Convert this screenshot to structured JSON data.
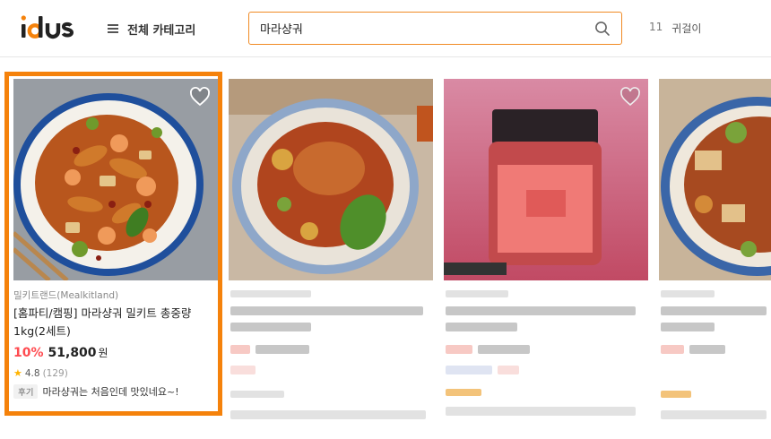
{
  "header": {
    "logo_text": "idus",
    "category_label": "전체 카테고리",
    "search": {
      "value": "마라샹궈",
      "placeholder": ""
    },
    "trending": {
      "rank": "11",
      "keyword": "귀걸이"
    }
  },
  "products": [
    {
      "seller": "밀키트랜드(Mealkitland)",
      "title": "[홈파티/캠핑] 마라샹궈 밀키트 총중량 1kg(2세트)",
      "discount": "10%",
      "price": "51,800",
      "currency": "원",
      "rating": "4.8",
      "review_count": "(129)",
      "review_tag": "후기",
      "review_text": "마라샹궈는 처음인데 맛있네요~!",
      "selected": true
    }
  ],
  "colors": {
    "accent": "#f5820b",
    "discount": "#ff4b50",
    "star": "#ffb400"
  }
}
